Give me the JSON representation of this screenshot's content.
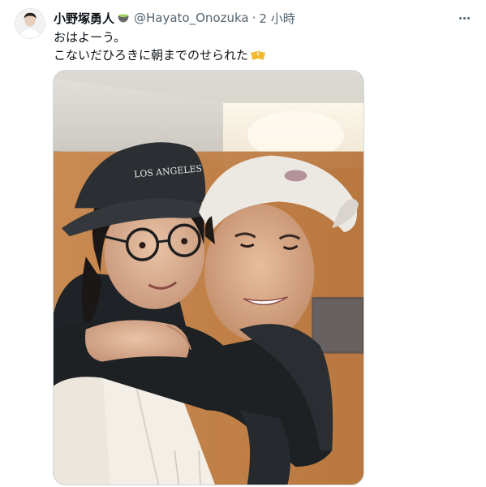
{
  "tweet": {
    "display_name": "小野塚勇人",
    "name_emoji": "matcha-icon",
    "handle": "@Hayato_Onozuka",
    "separator": "·",
    "time": "2 小時",
    "text_line1": "おはよーう。",
    "text_line2": "こないだひろきに朝までのせられた",
    "text_emoji": "beer-mugs-icon",
    "more_icon": "more-horizontal-icon"
  },
  "photo": {
    "cap_text": "LOS ANGELES"
  },
  "colors": {
    "text_primary": "#0f1419",
    "text_secondary": "#536471",
    "border": "#cfd9de"
  }
}
